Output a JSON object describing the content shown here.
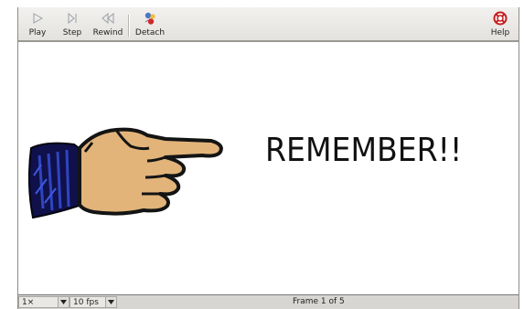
{
  "toolbar": {
    "play_label": "Play",
    "step_label": "Step",
    "rewind_label": "Rewind",
    "detach_label": "Detach",
    "help_label": "Help"
  },
  "canvas": {
    "text": "REMEMBER!!"
  },
  "statusbar": {
    "zoom_value": "1×",
    "fps_value": "10 fps",
    "frame_label": "Frame 1 of 5"
  }
}
